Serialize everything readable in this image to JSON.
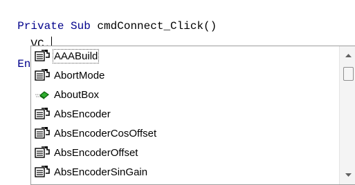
{
  "editor": {
    "line1_keyword": "Private Sub",
    "line1_rest": " cmdConnect_Click()",
    "line2_text": "  VC.",
    "line3_text": "End"
  },
  "autocomplete": {
    "items": [
      {
        "label": "AAABuild",
        "icon": "property-icon",
        "selected": true
      },
      {
        "label": "AbortMode",
        "icon": "property-icon"
      },
      {
        "label": "AboutBox",
        "icon": "method-icon"
      },
      {
        "label": "AbsEncoder",
        "icon": "property-icon"
      },
      {
        "label": "AbsEncoderCosOffset",
        "icon": "property-icon"
      },
      {
        "label": "AbsEncoderOffset",
        "icon": "property-icon"
      },
      {
        "label": "AbsEncoderSinGain",
        "icon": "property-icon"
      }
    ]
  }
}
